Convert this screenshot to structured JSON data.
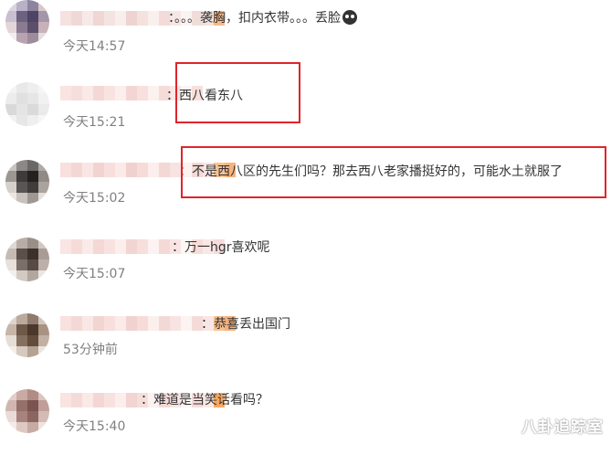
{
  "comments": [
    {
      "text": "：。。。袭胸，扣内衣带。。。丢脸",
      "time": "今天14:57",
      "avatar_colors": [
        "#d9d4e0",
        "#b9b1c7",
        "#8e84a0",
        "#d8c9c6",
        "#c8bfd0",
        "#6d6180",
        "#4e4464",
        "#a495aa",
        "#e3d6d8",
        "#8a7b93",
        "#5c4f6b",
        "#c9b2b7",
        "#f2eced",
        "#b7a4b0",
        "#9e8c9c",
        "#e6dde0"
      ],
      "name_colors": [
        "#f5e2e0",
        "#f0d8d6",
        "#f7e9e7",
        "#efd7d4",
        "#f3e3e1",
        "#f8eeec",
        "#eed3d0",
        "#f5e1de",
        "#f9efed",
        "#f2dbd8",
        "#f6e6e4",
        "#fbf3f2",
        "#f0ddd9",
        "#f3e2df",
        "#f7b986"
      ]
    },
    {
      "text": "：西八看东八",
      "time": "今天15:21",
      "avatar_colors": [
        "#f3f3f3",
        "#e8e8e8",
        "#eeeeee",
        "#f5f5f5",
        "#ececec",
        "#e0e0e0",
        "#e6e6e6",
        "#f1f1f1",
        "#d9d9d9",
        "#e4e4e4",
        "#dadada",
        "#eaeaea",
        "#f2f2f2",
        "#e7e7e7",
        "#efefef",
        "#f6f6f6"
      ],
      "name_colors": [
        "#f9e4e2",
        "#f6dedc",
        "#fae9e7",
        "#f4d8d5",
        "#f8e3e1",
        "#fbeeec",
        "#f3d6d3",
        "#f7e0de",
        "#fcf1ef",
        "#f5dcd9",
        "#f9e7e5",
        "#fdf5f4",
        "#f6dfdc"
      ]
    },
    {
      "text": "：不是西八区的先生们吗？那去西八老家播挺好的，可能水土就服了",
      "time": "今天15:02",
      "avatar_colors": [
        "#c7c3c0",
        "#8c8886",
        "#6b6765",
        "#b0aaa6",
        "#9b9691",
        "#3f3b3a",
        "#25211f",
        "#8f8a86",
        "#d6d0cb",
        "#5a5552",
        "#403c3a",
        "#aaa39d",
        "#ece7e3",
        "#c9c2bc",
        "#9e9792",
        "#e5dfda"
      ],
      "name_colors": [
        "#f8e0de",
        "#f4d7d4",
        "#f9e6e4",
        "#f2d3d0",
        "#f6dfdc",
        "#faeae8",
        "#f1d1ce",
        "#f5dcd9",
        "#fbeeec",
        "#f3d8d5",
        "#f7e3e1",
        "#fcf2f1",
        "#f4dad7",
        "#f8e5e3",
        "#f9c293",
        "#f6b37d"
      ]
    },
    {
      "text": "：万一hgr喜欢呢",
      "time": "今天15:07",
      "avatar_colors": [
        "#ded8d4",
        "#b8aea7",
        "#9a8f88",
        "#d2c8c1",
        "#c6bbb3",
        "#5b504a",
        "#3c322d",
        "#a89c94",
        "#e7e0db",
        "#7b6f68",
        "#574b45",
        "#bcb0a8",
        "#f3efec",
        "#d3cac4",
        "#b2a79f",
        "#ece6e2"
      ],
      "name_colors": [
        "#f9e5e3",
        "#f5dcd9",
        "#faeae8",
        "#f3d8d5",
        "#f7e2e0",
        "#fbeeec",
        "#f2d5d2",
        "#f6dfdc",
        "#fcf2f1",
        "#f4dad7",
        "#f8e5e3",
        "#fdf6f5",
        "#f5ddda",
        "#f9e8e6",
        "#f6dcdb"
      ]
    },
    {
      "text": "：恭喜丢出国门",
      "time": "53分钟前",
      "avatar_colors": [
        "#ddd4cc",
        "#bba99c",
        "#8f7b6d",
        "#d4c6bb",
        "#c7b5a7",
        "#6e5848",
        "#4a382b",
        "#a89383",
        "#e6ddd5",
        "#85705f",
        "#624c3c",
        "#c2b0a2",
        "#f2ede8",
        "#d6c9be",
        "#b5a293",
        "#ebe4dd"
      ],
      "name_colors": [
        "#f8e1df",
        "#f4d8d5",
        "#f9e7e5",
        "#f2d4d1",
        "#f6dfdc",
        "#faebe9",
        "#f1d2cf",
        "#f5dcd9",
        "#fbefed",
        "#f3d9d6",
        "#f7e4e2",
        "#fcf3f2",
        "#f4dbd8",
        "#f8e6e4",
        "#f9c08f",
        "#f7b07a"
      ]
    },
    {
      "text": "：难道是当笑话看吗？",
      "time": "今天15:40",
      "avatar_colors": [
        "#e2cfcb",
        "#c9aaa4",
        "#b18c85",
        "#dcc4bf",
        "#d1b6b0",
        "#95706a",
        "#7a5550",
        "#c29e98",
        "#eadbd8",
        "#a8827c",
        "#8b6661",
        "#d5bbb6",
        "#f4ebe9",
        "#dfc8c3",
        "#c7aaa4",
        "#efe3e0"
      ],
      "name_colors": [
        "#f9e4e2",
        "#f5dbd8",
        "#fae9e7",
        "#f3d7d4",
        "#f7e2e0",
        "#fbeeec",
        "#f2d4d1",
        "#f6dedb",
        "#fcf2f1",
        "#f4d9d6",
        "#f8e4e2",
        "#fdf5f4",
        "#f5dcd9",
        "#f9e7e5",
        "#f8a860"
      ]
    }
  ],
  "highlight_color": "#e0242b",
  "emoji_icon": "sad-face-icon",
  "watermark": "八卦追踪室"
}
